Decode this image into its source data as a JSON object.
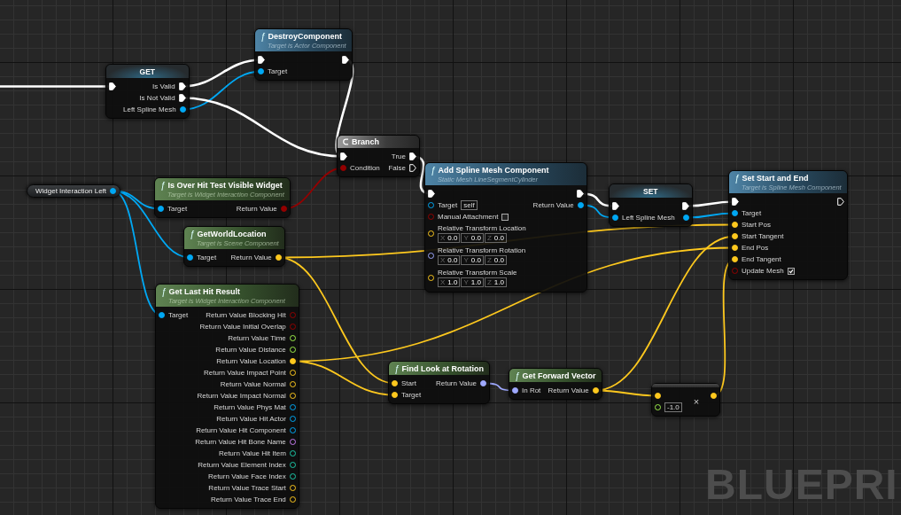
{
  "nodes": [
    {
      "kind": "get",
      "title": "GET",
      "inputs": [
        {
          "kind": "exec",
          "connected": true
        }
      ],
      "outputs": [
        {
          "kind": "exec",
          "label": "Is Valid",
          "connected": true
        },
        {
          "kind": "exec",
          "label": "Is Not Valid",
          "connected": true
        },
        {
          "kind": "object",
          "label": "Left Spline Mesh",
          "connected": true
        }
      ]
    },
    {
      "kind": "call",
      "icon": "ƒ",
      "title": "DestroyComponent",
      "subtitle": "Target is Actor Component",
      "inputs": [
        {
          "kind": "exec",
          "connected": true
        },
        {
          "kind": "object",
          "label": "Target",
          "connected": true
        }
      ],
      "outputs": [
        {
          "kind": "exec",
          "connected": true
        }
      ]
    },
    {
      "kind": "branch",
      "title": "Branch",
      "inputs": [
        {
          "kind": "exec",
          "connected": true
        },
        {
          "kind": "bool",
          "label": "Condition",
          "connected": true
        }
      ],
      "outputs": [
        {
          "kind": "exec",
          "label": "True",
          "connected": true
        },
        {
          "kind": "exec",
          "label": "False",
          "connected": false
        }
      ]
    },
    {
      "kind": "variable",
      "title": "Widget Interaction Left",
      "outputs": [
        {
          "kind": "object",
          "connected": true
        }
      ]
    },
    {
      "kind": "pure",
      "icon": "ƒ",
      "title": "Is Over Hit Test Visible Widget",
      "subtitle": "Target is Widget Interaction Component",
      "inputs": [
        {
          "kind": "object",
          "label": "Target",
          "connected": true
        }
      ],
      "outputs": [
        {
          "kind": "bool",
          "label": "Return Value",
          "connected": true
        }
      ]
    },
    {
      "kind": "pure",
      "icon": "ƒ",
      "title": "GetWorldLocation",
      "subtitle": "Target is Scene Component",
      "inputs": [
        {
          "kind": "object",
          "label": "Target",
          "connected": true
        }
      ],
      "outputs": [
        {
          "kind": "vector",
          "label": "Return Value",
          "connected": true
        }
      ]
    },
    {
      "kind": "pure",
      "icon": "ƒ",
      "title": "Get Last Hit Result",
      "subtitle": "Target is Widget Interaction Component",
      "inputs": [
        {
          "kind": "object",
          "label": "Target",
          "connected": true
        }
      ],
      "outputs": [
        {
          "kind": "bool",
          "label": "Return Value Blocking Hit",
          "connected": false
        },
        {
          "kind": "bool",
          "label": "Return Value Initial Overlap",
          "connected": false
        },
        {
          "kind": "float",
          "label": "Return Value Time",
          "connected": false
        },
        {
          "kind": "float",
          "label": "Return Value Distance",
          "connected": false
        },
        {
          "kind": "vector",
          "label": "Return Value Location",
          "connected": true
        },
        {
          "kind": "vector",
          "label": "Return Value Impact Point",
          "connected": false
        },
        {
          "kind": "vector",
          "label": "Return Value Normal",
          "connected": false
        },
        {
          "kind": "vector",
          "label": "Return Value Impact Normal",
          "connected": false
        },
        {
          "kind": "object",
          "label": "Return Value Phys Mat",
          "connected": false
        },
        {
          "kind": "object",
          "label": "Return Value Hit Actor",
          "connected": false
        },
        {
          "kind": "object",
          "label": "Return Value Hit Component",
          "connected": false
        },
        {
          "kind": "name",
          "label": "Return Value Hit Bone Name",
          "connected": false
        },
        {
          "kind": "int",
          "label": "Return Value Hit Item",
          "connected": false
        },
        {
          "kind": "int",
          "label": "Return Value Element Index",
          "connected": false
        },
        {
          "kind": "int",
          "label": "Return Value Face Index",
          "connected": false
        },
        {
          "kind": "vector",
          "label": "Return Value Trace Start",
          "connected": false
        },
        {
          "kind": "vector",
          "label": "Return Value Trace End",
          "connected": false
        }
      ]
    },
    {
      "kind": "call",
      "icon": "ƒ",
      "title": "Add Spline Mesh Component",
      "subtitle": "Static Mesh LineSegmentCylinder",
      "inputs": [
        {
          "kind": "exec",
          "connected": true
        },
        {
          "kind": "object",
          "label": "Target",
          "connected": false,
          "value": "self"
        },
        {
          "kind": "bool",
          "label": "Manual Attachment",
          "connected": false,
          "checked": false
        },
        {
          "kind": "vector",
          "label": "Relative Transform Location",
          "connected": false,
          "fields": [
            {
              "axis": "X",
              "value": "0.0"
            },
            {
              "axis": "Y",
              "value": "0.0"
            },
            {
              "axis": "Z",
              "value": "0.0"
            }
          ]
        },
        {
          "kind": "rotator",
          "label": "Relative Transform Rotation",
          "connected": false,
          "fields": [
            {
              "axis": "X",
              "value": "0.0"
            },
            {
              "axis": "Y",
              "value": "0.0"
            },
            {
              "axis": "Z",
              "value": "0.0"
            }
          ]
        },
        {
          "kind": "vector",
          "label": "Relative Transform Scale",
          "connected": false,
          "fields": [
            {
              "axis": "X",
              "value": "1.0"
            },
            {
              "axis": "Y",
              "value": "1.0"
            },
            {
              "axis": "Z",
              "value": "1.0"
            }
          ]
        }
      ],
      "outputs": [
        {
          "kind": "exec",
          "connected": true
        },
        {
          "kind": "object",
          "label": "Return Value",
          "connected": true
        }
      ]
    },
    {
      "kind": "set",
      "title": "SET",
      "inputs": [
        {
          "kind": "exec",
          "connected": true
        },
        {
          "kind": "object",
          "label": "Left Spline Mesh",
          "connected": true
        }
      ],
      "outputs": [
        {
          "kind": "exec",
          "connected": true
        },
        {
          "kind": "object",
          "connected": true
        }
      ]
    },
    {
      "kind": "call",
      "icon": "ƒ",
      "title": "Set Start and End",
      "subtitle": "Target is Spline Mesh Component",
      "inputs": [
        {
          "kind": "exec",
          "connected": true
        },
        {
          "kind": "object",
          "label": "Target",
          "connected": true
        },
        {
          "kind": "vector",
          "label": "Start Pos",
          "connected": true
        },
        {
          "kind": "vector",
          "label": "Start Tangent",
          "connected": true
        },
        {
          "kind": "vector",
          "label": "End Pos",
          "connected": true
        },
        {
          "kind": "vector",
          "label": "End Tangent",
          "connected": true
        },
        {
          "kind": "bool",
          "label": "Update Mesh",
          "connected": false,
          "checked": true
        }
      ],
      "outputs": [
        {
          "kind": "exec",
          "connected": false
        }
      ]
    },
    {
      "kind": "pure",
      "icon": "ƒ",
      "title": "Find Look at Rotation",
      "inputs": [
        {
          "kind": "vector",
          "label": "Start",
          "connected": true
        },
        {
          "kind": "vector",
          "label": "Target",
          "connected": true
        }
      ],
      "outputs": [
        {
          "kind": "rotator",
          "label": "Return Value",
          "connected": true
        }
      ]
    },
    {
      "kind": "pure",
      "icon": "ƒ",
      "title": "Get Forward Vector",
      "inputs": [
        {
          "kind": "rotator",
          "label": "In Rot",
          "connected": true
        }
      ],
      "outputs": [
        {
          "kind": "vector",
          "label": "Return Value",
          "connected": true
        }
      ]
    },
    {
      "kind": "math",
      "title": "×",
      "inputs": [
        {
          "kind": "vector",
          "connected": true
        },
        {
          "kind": "float",
          "connected": false,
          "value": "-1.0"
        }
      ],
      "outputs": [
        {
          "kind": "vector",
          "connected": true
        }
      ]
    }
  ],
  "watermark": "BLUEPRI"
}
